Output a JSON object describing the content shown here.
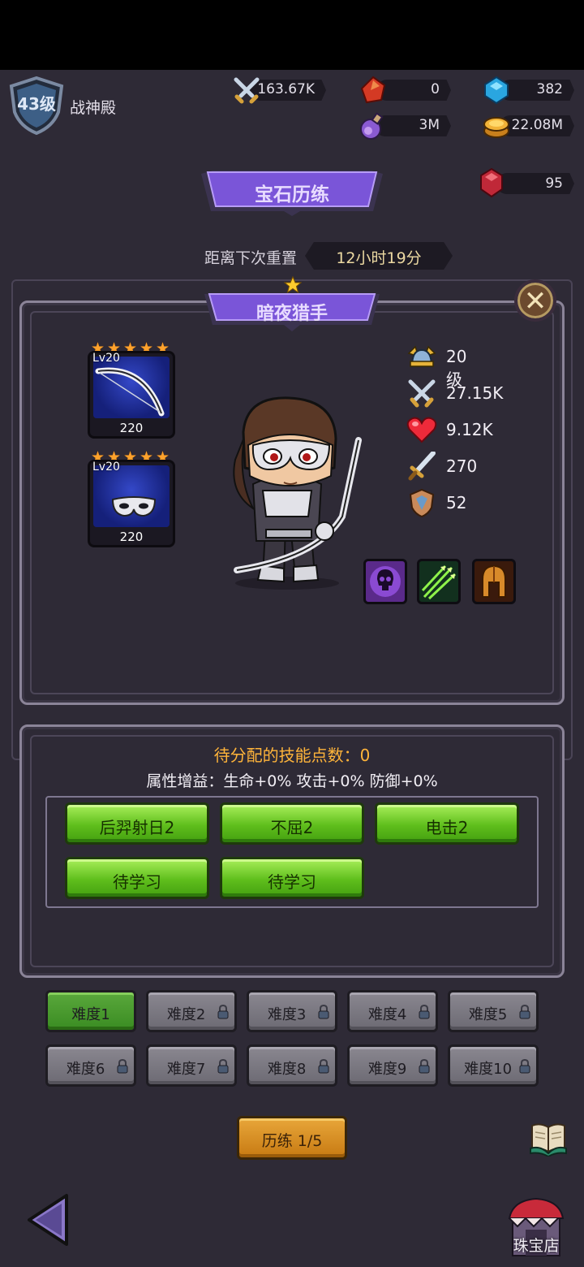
{
  "header": {
    "level_label": "43级",
    "hall_name": "战神殿",
    "resources": [
      {
        "icon": "crossed-swords-icon",
        "value": "163.67K"
      },
      {
        "icon": "red-gem-icon",
        "value": "0"
      },
      {
        "icon": "blue-gem-icon",
        "value": "382"
      },
      {
        "icon": "potion-icon",
        "value": "3M"
      },
      {
        "icon": "gold-coins-icon",
        "value": "22.08M"
      }
    ],
    "ruby": {
      "icon": "ruby-icon",
      "value": "95"
    }
  },
  "event_title": "宝石历练",
  "reset": {
    "label": "距离下次重置",
    "time": "12小时19分"
  },
  "hero": {
    "name": "暗夜猎手",
    "equipment": [
      {
        "icon": "bow-icon",
        "level": "Lv20",
        "value": "220",
        "stars": 5
      },
      {
        "icon": "mask-icon",
        "level": "Lv20",
        "value": "220",
        "stars": 5
      }
    ],
    "stats": [
      {
        "icon": "helmet-level-icon",
        "value": "20级"
      },
      {
        "icon": "attack-swords-icon",
        "value": "27.15K"
      },
      {
        "icon": "heart-icon",
        "value": "9.12K"
      },
      {
        "icon": "sword-icon",
        "value": "270"
      },
      {
        "icon": "shield-icon",
        "value": "52"
      }
    ],
    "skill_icons": [
      "skull-skill-icon",
      "arrows-skill-icon",
      "spartan-helmet-skill-icon"
    ]
  },
  "skill_points": {
    "title": "待分配的技能点数：0",
    "attributes": "属性增益：生命+0% 攻击+0% 防御+0%",
    "skills": [
      "后羿射日2",
      "不屈2",
      "电击2",
      "待学习",
      "待学习"
    ]
  },
  "difficulties": [
    {
      "label": "难度1",
      "locked": false
    },
    {
      "label": "难度2",
      "locked": true
    },
    {
      "label": "难度3",
      "locked": true
    },
    {
      "label": "难度4",
      "locked": true
    },
    {
      "label": "难度5",
      "locked": true
    },
    {
      "label": "难度6",
      "locked": true
    },
    {
      "label": "难度7",
      "locked": true
    },
    {
      "label": "难度8",
      "locked": true
    },
    {
      "label": "难度9",
      "locked": true
    },
    {
      "label": "难度10",
      "locked": true
    }
  ],
  "train_button": "历练 1/5",
  "shop_label": "珠宝店",
  "colors": {
    "accent_purple": "#7a55d8",
    "skill_green": "#5fbe1c",
    "train_orange": "#d98b22",
    "active_green": "#3a8c22"
  }
}
